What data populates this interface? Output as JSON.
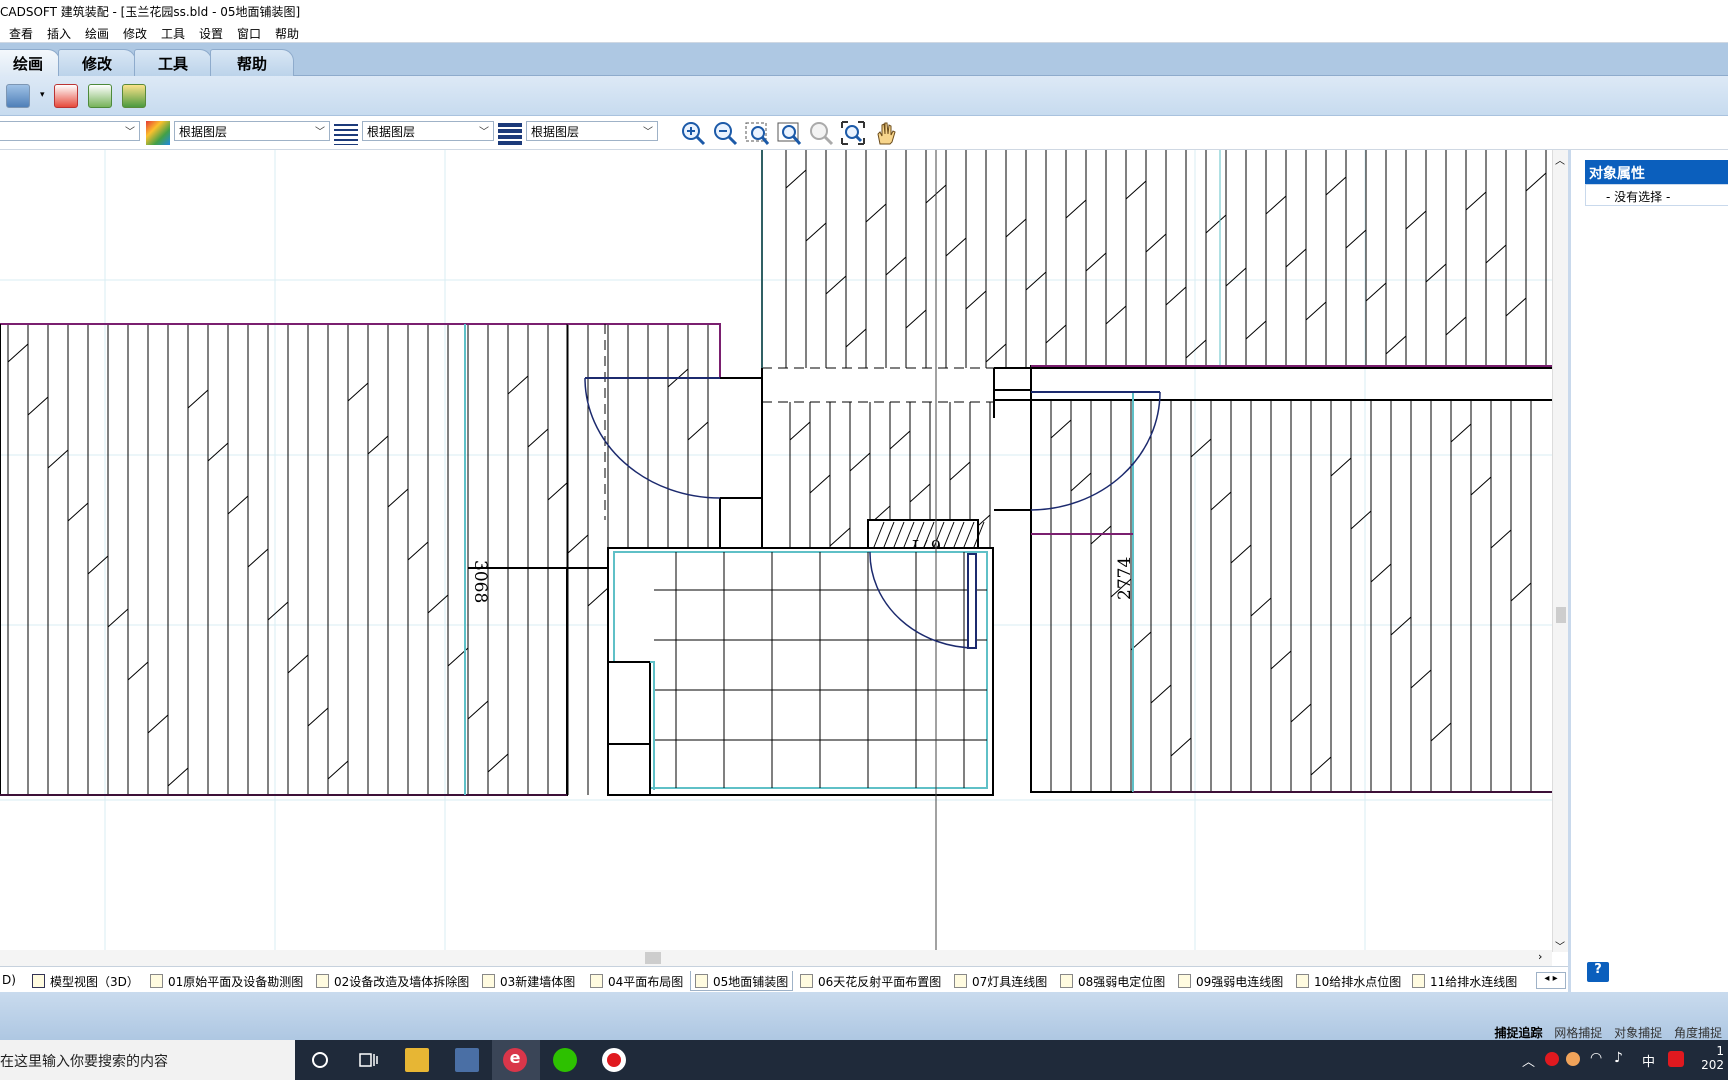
{
  "titlebar": {
    "title": "CADSOFT 建筑装配 - [玉兰花园ss.bld - 05地面铺装图]"
  },
  "menu": [
    "查看",
    "插入",
    "绘画",
    "修改",
    "工具",
    "设置",
    "窗口",
    "帮助"
  ],
  "ribbon_tabs": [
    "绘画",
    "修改",
    "工具",
    "帮助"
  ],
  "properties_bar": {
    "color_value": "根据图层",
    "linetype_value": "根据图层",
    "lineweight_value": "根据图层"
  },
  "drawing": {
    "dimension_left": "3068",
    "dimension_door": "671",
    "dimension_right": "2774"
  },
  "panel": {
    "title": "对象属性",
    "selection": "- 没有选择 -",
    "help": "?"
  },
  "layout_tabs": [
    "D)",
    "模型视图（3D）",
    "01原始平面及设备勘测图",
    "02设备改造及墙体拆除图",
    "03新建墙体图",
    "04平面布局图",
    "05地面铺装图",
    "06天花反射平面布置图",
    "07灯具连线图",
    "08强弱电定位图",
    "09强弱电连线图",
    "10给排水点位图",
    "11给排水连线图"
  ],
  "active_layout_tab": "05地面铺装图",
  "status": [
    "捕捉追踪",
    "网格捕捉",
    "对象捕捉",
    "角度捕捉"
  ],
  "taskbar": {
    "search_placeholder": "在这里输入你要搜索的内容",
    "tray_lang": "中",
    "clock_line1": "1",
    "clock_line2": "202"
  },
  "colors": {
    "ribbon": "#aec8e3",
    "panel_title": "#0b5fbd",
    "taskbar": "#1f2a3a",
    "wall": "#000000",
    "boundary": "#7a1f6f",
    "door_arc": "#1c2a6e",
    "cyan_line": "#5fc0c7"
  }
}
